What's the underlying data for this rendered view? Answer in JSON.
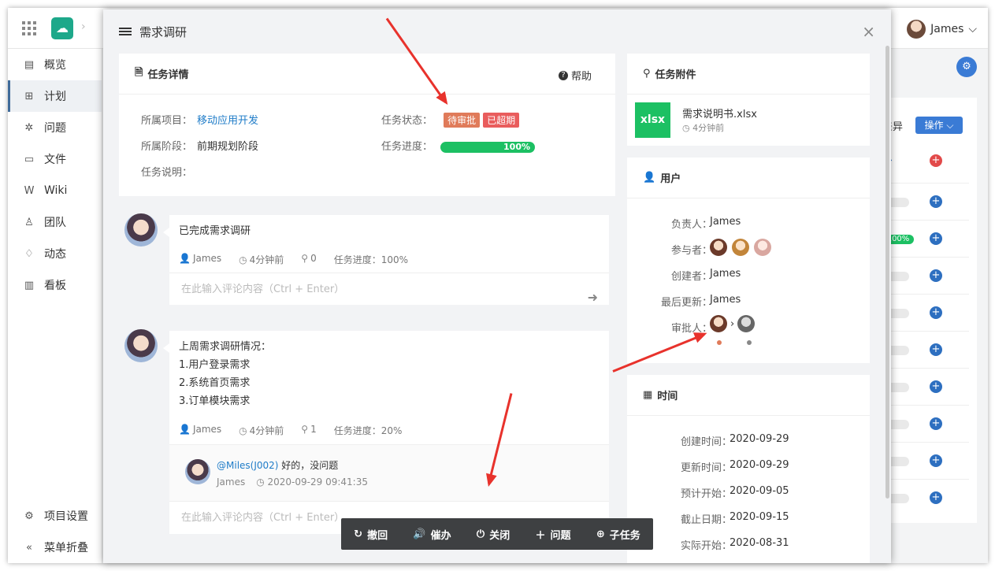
{
  "topbar": {
    "user_name": "James"
  },
  "sidebar": {
    "items": [
      {
        "label": "概览",
        "icon": "overview-icon"
      },
      {
        "label": "计划",
        "icon": "plan-icon"
      },
      {
        "label": "问题",
        "icon": "bug-icon"
      },
      {
        "label": "文件",
        "icon": "folder-icon"
      },
      {
        "label": "Wiki",
        "icon": "wiki-icon"
      },
      {
        "label": "团队",
        "icon": "team-icon"
      },
      {
        "label": "动态",
        "icon": "activity-icon"
      },
      {
        "label": "看板",
        "icon": "board-icon"
      }
    ],
    "settings": "项目设置",
    "collapse": "菜单折叠"
  },
  "background": {
    "label": "差异",
    "op_button": "操作",
    "progress": "100%"
  },
  "modal": {
    "title": "需求调研",
    "detail": {
      "title": "任务详情",
      "help": "帮助",
      "project_label": "所属项目：",
      "project_value": "移动应用开发",
      "stage_label": "所属阶段：",
      "stage_value": "前期规划阶段",
      "desc_label": "任务说明：",
      "status_label": "任务状态：",
      "status_tags": [
        "待审批",
        "已超期"
      ],
      "progress_label": "任务进度：",
      "progress_value": "100%",
      "progress_fraction": 1.0
    },
    "comments": [
      {
        "lines": [
          "已完成需求调研"
        ],
        "author": "James",
        "time": "4分钟前",
        "attachments": "0",
        "progress": "任务进度：100%",
        "placeholder": "在此输入评论内容（Ctrl + Enter）"
      },
      {
        "lines": [
          "上周需求调研情况：",
          "1.用户登录需求",
          "2.系统首页需求",
          "3.订单模块需求"
        ],
        "author": "James",
        "time": "4分钟前",
        "attachments": "1",
        "progress": "任务进度：20%",
        "reply": {
          "mention": "@Miles(J002)",
          "text": " 好的，没问题",
          "author": "James",
          "time": "2020-09-29 09:41:35"
        },
        "placeholder": "在此输入评论内容（Ctrl + Enter）"
      }
    ],
    "attachments": {
      "title": "任务附件",
      "file_type": "xlsx",
      "file_name": "需求说明书.xlsx",
      "file_time": "4分钟前"
    },
    "users": {
      "title": "用户",
      "owner_label": "负责人：",
      "owner": "James",
      "participants_label": "参与者：",
      "creator_label": "创建者：",
      "creator": "James",
      "updater_label": "最后更新：",
      "updater": "James",
      "approver_label": "审批人："
    },
    "time": {
      "title": "时间",
      "rows": [
        {
          "label": "创建时间：",
          "value": "2020-09-29"
        },
        {
          "label": "更新时间：",
          "value": "2020-09-29"
        },
        {
          "label": "预计开始：",
          "value": "2020-09-05"
        },
        {
          "label": "截止日期：",
          "value": "2020-09-15"
        },
        {
          "label": "实际开始：",
          "value": "2020-08-31"
        }
      ]
    },
    "toolbar": {
      "undo": "撤回",
      "remind": "催办",
      "close": "关闭",
      "issue": "问题",
      "subtask": "子任务"
    }
  }
}
